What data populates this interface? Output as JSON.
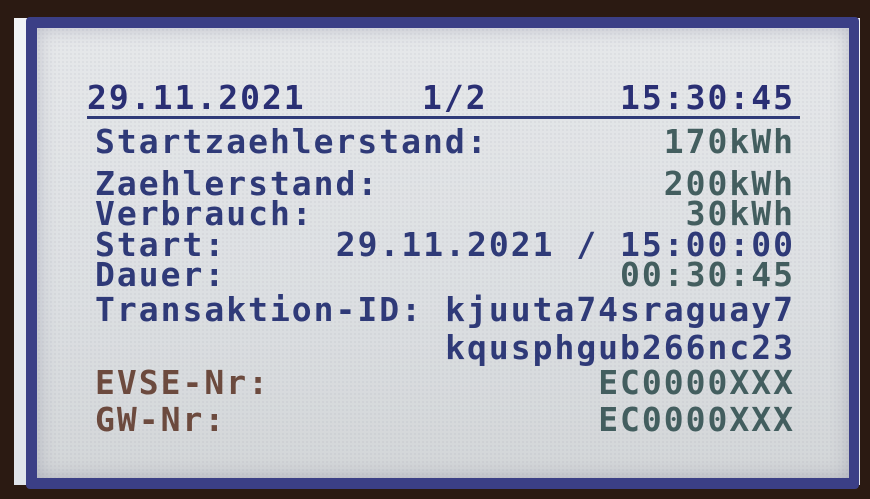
{
  "header": {
    "date": "29.11.2021",
    "page": "1/2",
    "time": "15:30:45"
  },
  "rows": [
    {
      "label": "Startzaehlerstand:",
      "value": "170kWh"
    },
    {
      "label": "Zaehlerstand:",
      "value": "200kWh"
    },
    {
      "label": "Verbrauch:",
      "value": "30kWh"
    },
    {
      "label": "Start:",
      "value": "29.11.2021 / 15:00:00"
    },
    {
      "label": "Dauer:",
      "value": "00:30:45"
    },
    {
      "label": "Transaktion-ID:",
      "value": "kjuuta74sraguay7"
    },
    {
      "label": "",
      "value": "kqusphgub266nc23"
    },
    {
      "label": "EVSE-Nr:",
      "value": "EC0000XXX"
    },
    {
      "label": "GW-Nr:",
      "value": "EC0000XXX"
    }
  ],
  "colors": {
    "lcd_text": "#2f3a78",
    "lcd_bg": "#e1e3e5",
    "border": "#3b3f86"
  }
}
